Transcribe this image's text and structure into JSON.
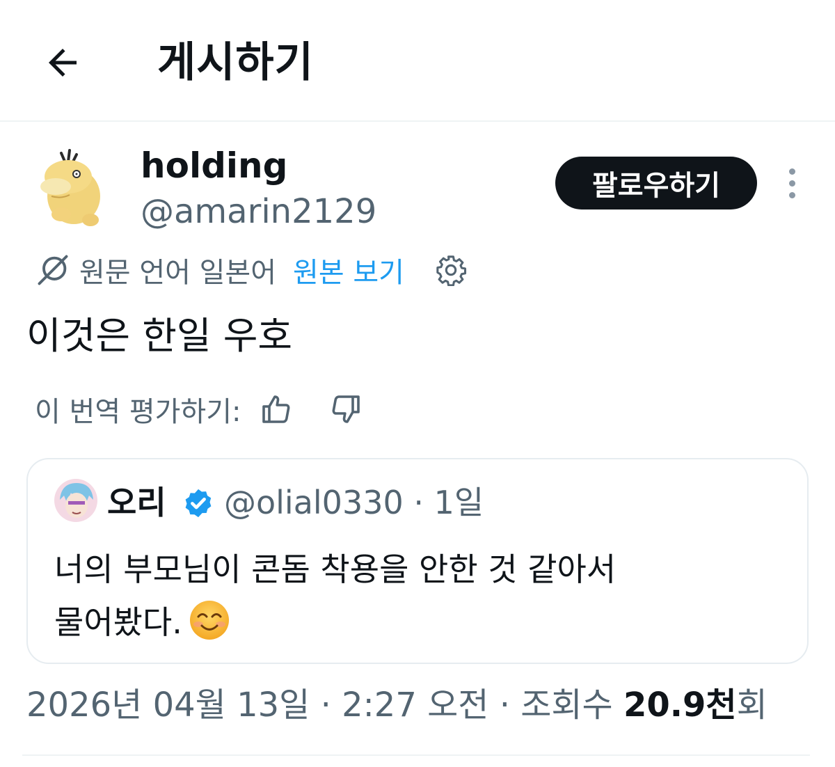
{
  "header": {
    "title": "게시하기",
    "back_icon": "arrow-left-icon"
  },
  "author": {
    "display_name": "holding",
    "handle": "@amarin2129",
    "avatar_icon": "psyduck-avatar"
  },
  "follow_button": {
    "label": "팔로우하기"
  },
  "more_icon": "more-vertical-icon",
  "translation": {
    "notice": "원문 언어 일본어",
    "show_original": "원본 보기",
    "settings_icon": "gear-icon"
  },
  "tweet": {
    "text": "이것은 한일 우호"
  },
  "rating": {
    "label": "이 번역 평가하기:",
    "thumbs_up_icon": "thumbs-up-icon",
    "thumbs_down_icon": "thumbs-down-icon"
  },
  "quote": {
    "display_name": "오리",
    "verified": true,
    "handle_time": "@olial0330 · 1일",
    "text_line1": "너의 부모님이 콘돔 착용을 안한 것 같아서",
    "text_line2": "물어봤다.",
    "emoji": "smiling-face-emoji"
  },
  "meta": {
    "timestamp": "2026년 04월 13일 · 2:27 오전 · 조회수 ",
    "views_count": "20.9천",
    "views_suffix": "회"
  },
  "colors": {
    "accent": "#1d9bf0",
    "text": "#0f1419",
    "muted": "#536471",
    "button_bg": "#0f1419"
  }
}
